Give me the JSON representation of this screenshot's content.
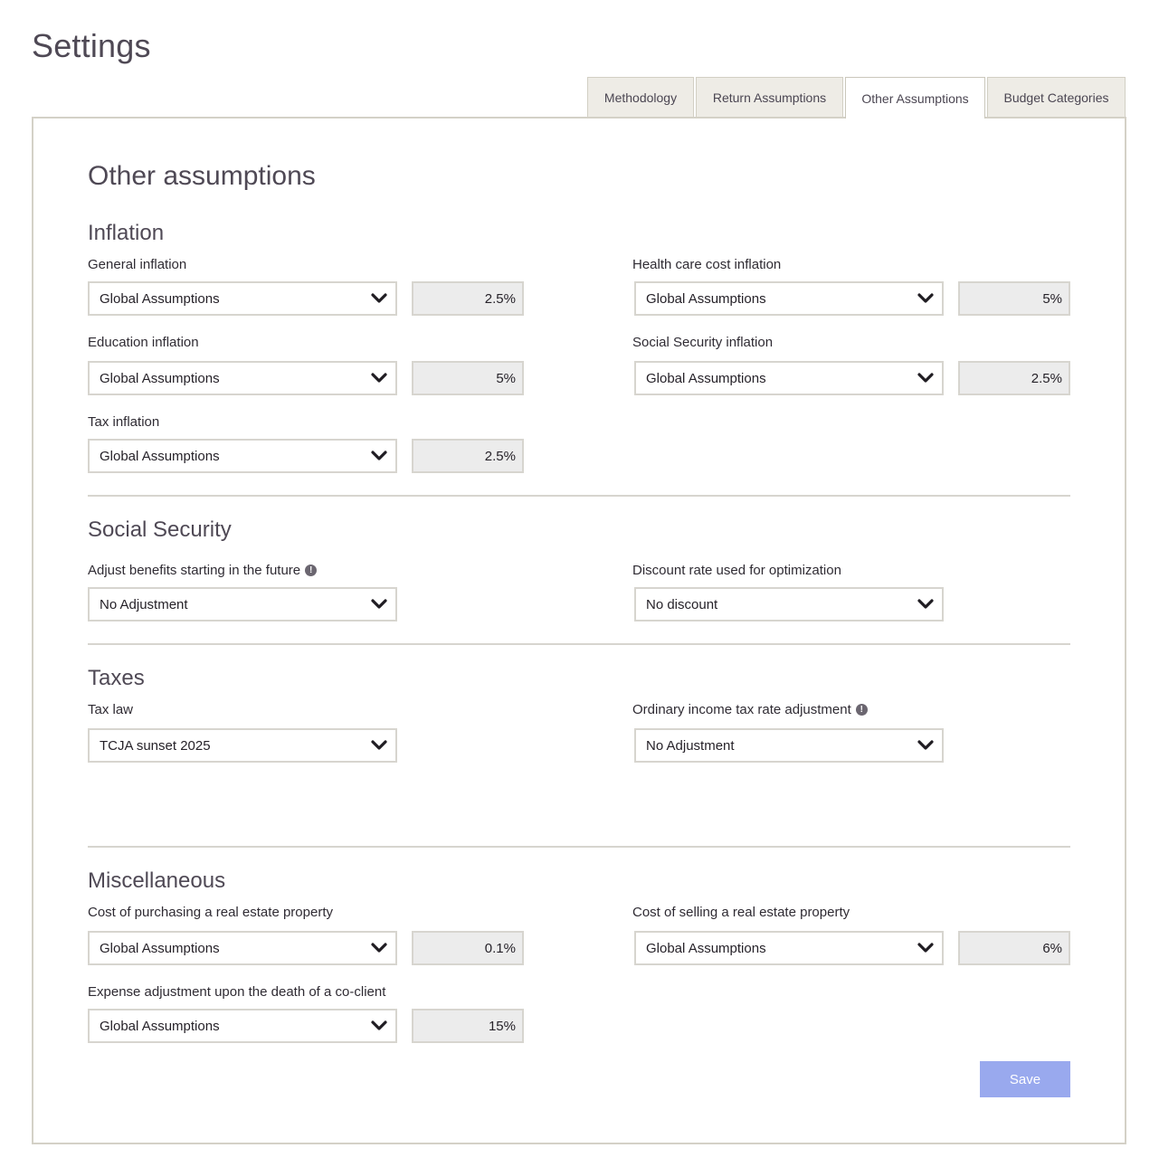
{
  "page": {
    "title": "Settings"
  },
  "tabs": [
    {
      "label": "Methodology",
      "active": false
    },
    {
      "label": "Return Assumptions",
      "active": false
    },
    {
      "label": "Other Assumptions",
      "active": true
    },
    {
      "label": "Budget Categories",
      "active": false
    }
  ],
  "panel": {
    "title": "Other assumptions"
  },
  "inflation": {
    "heading": "Inflation",
    "general": {
      "label": "General inflation",
      "select": "Global Assumptions",
      "value": "2.5%"
    },
    "health": {
      "label": "Health care cost inflation",
      "select": "Global Assumptions",
      "value": "5%"
    },
    "education": {
      "label": "Education inflation",
      "select": "Global Assumptions",
      "value": "5%"
    },
    "social_security": {
      "label": "Social Security inflation",
      "select": "Global Assumptions",
      "value": "2.5%"
    },
    "tax": {
      "label": "Tax inflation",
      "select": "Global Assumptions",
      "value": "2.5%"
    }
  },
  "social_security": {
    "heading": "Social Security",
    "adjust": {
      "label": "Adjust benefits starting in the future",
      "select": "No Adjustment"
    },
    "discount": {
      "label": "Discount rate used for optimization",
      "select": "No discount"
    }
  },
  "taxes": {
    "heading": "Taxes",
    "law": {
      "label": "Tax law",
      "select": "TCJA sunset 2025"
    },
    "ordinary": {
      "label": "Ordinary income tax rate adjustment",
      "select": "No Adjustment"
    }
  },
  "misc": {
    "heading": "Miscellaneous",
    "purchase": {
      "label": "Cost of purchasing a real estate property",
      "select": "Global Assumptions",
      "value": "0.1%"
    },
    "selling": {
      "label": "Cost of selling a real estate property",
      "select": "Global Assumptions",
      "value": "6%"
    },
    "expense": {
      "label": "Expense adjustment upon the death of a co-client",
      "select": "Global Assumptions",
      "value": "15%"
    }
  },
  "actions": {
    "save_label": "Save"
  },
  "icons": {
    "info": "info-icon",
    "dropdown": "chevron-down-icon"
  },
  "colors": {
    "save_button": "#99a9ee",
    "tab_inactive": "#eeece6",
    "value_box": "#ececec"
  }
}
